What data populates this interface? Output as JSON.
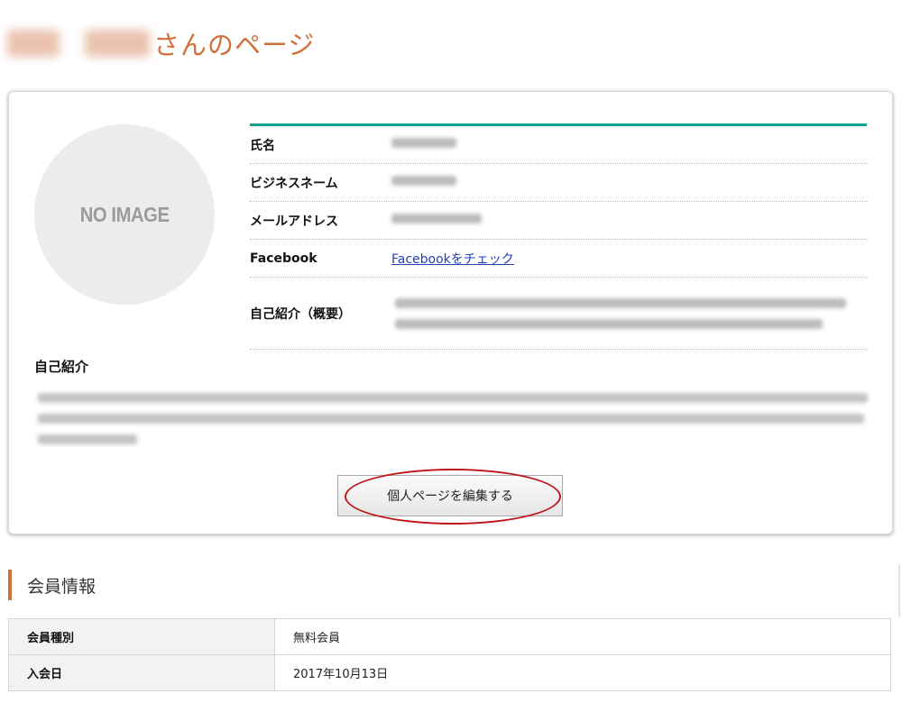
{
  "page": {
    "title_suffix": "さんのページ"
  },
  "avatar": {
    "placeholder": "NO IMAGE"
  },
  "profile": {
    "rows": [
      {
        "label": "氏名"
      },
      {
        "label": "ビジネスネーム"
      },
      {
        "label": "メールアドレス"
      },
      {
        "label": "Facebook",
        "link_text": "Facebookをチェック"
      },
      {
        "label": "自己紹介（概要）"
      }
    ]
  },
  "intro": {
    "heading": "自己紹介"
  },
  "actions": {
    "edit_label": "個人ページを編集する"
  },
  "annotation": {
    "color": "#c0141b"
  },
  "membership": {
    "heading": "会員情報",
    "rows": [
      {
        "key": "会員種別",
        "value": "無料会員"
      },
      {
        "key": "入会日",
        "value": "2017年10月13日"
      }
    ]
  },
  "theme": {
    "accent_orange": "#d2703c",
    "accent_teal": "#16a190",
    "link_blue": "#2340b8"
  }
}
